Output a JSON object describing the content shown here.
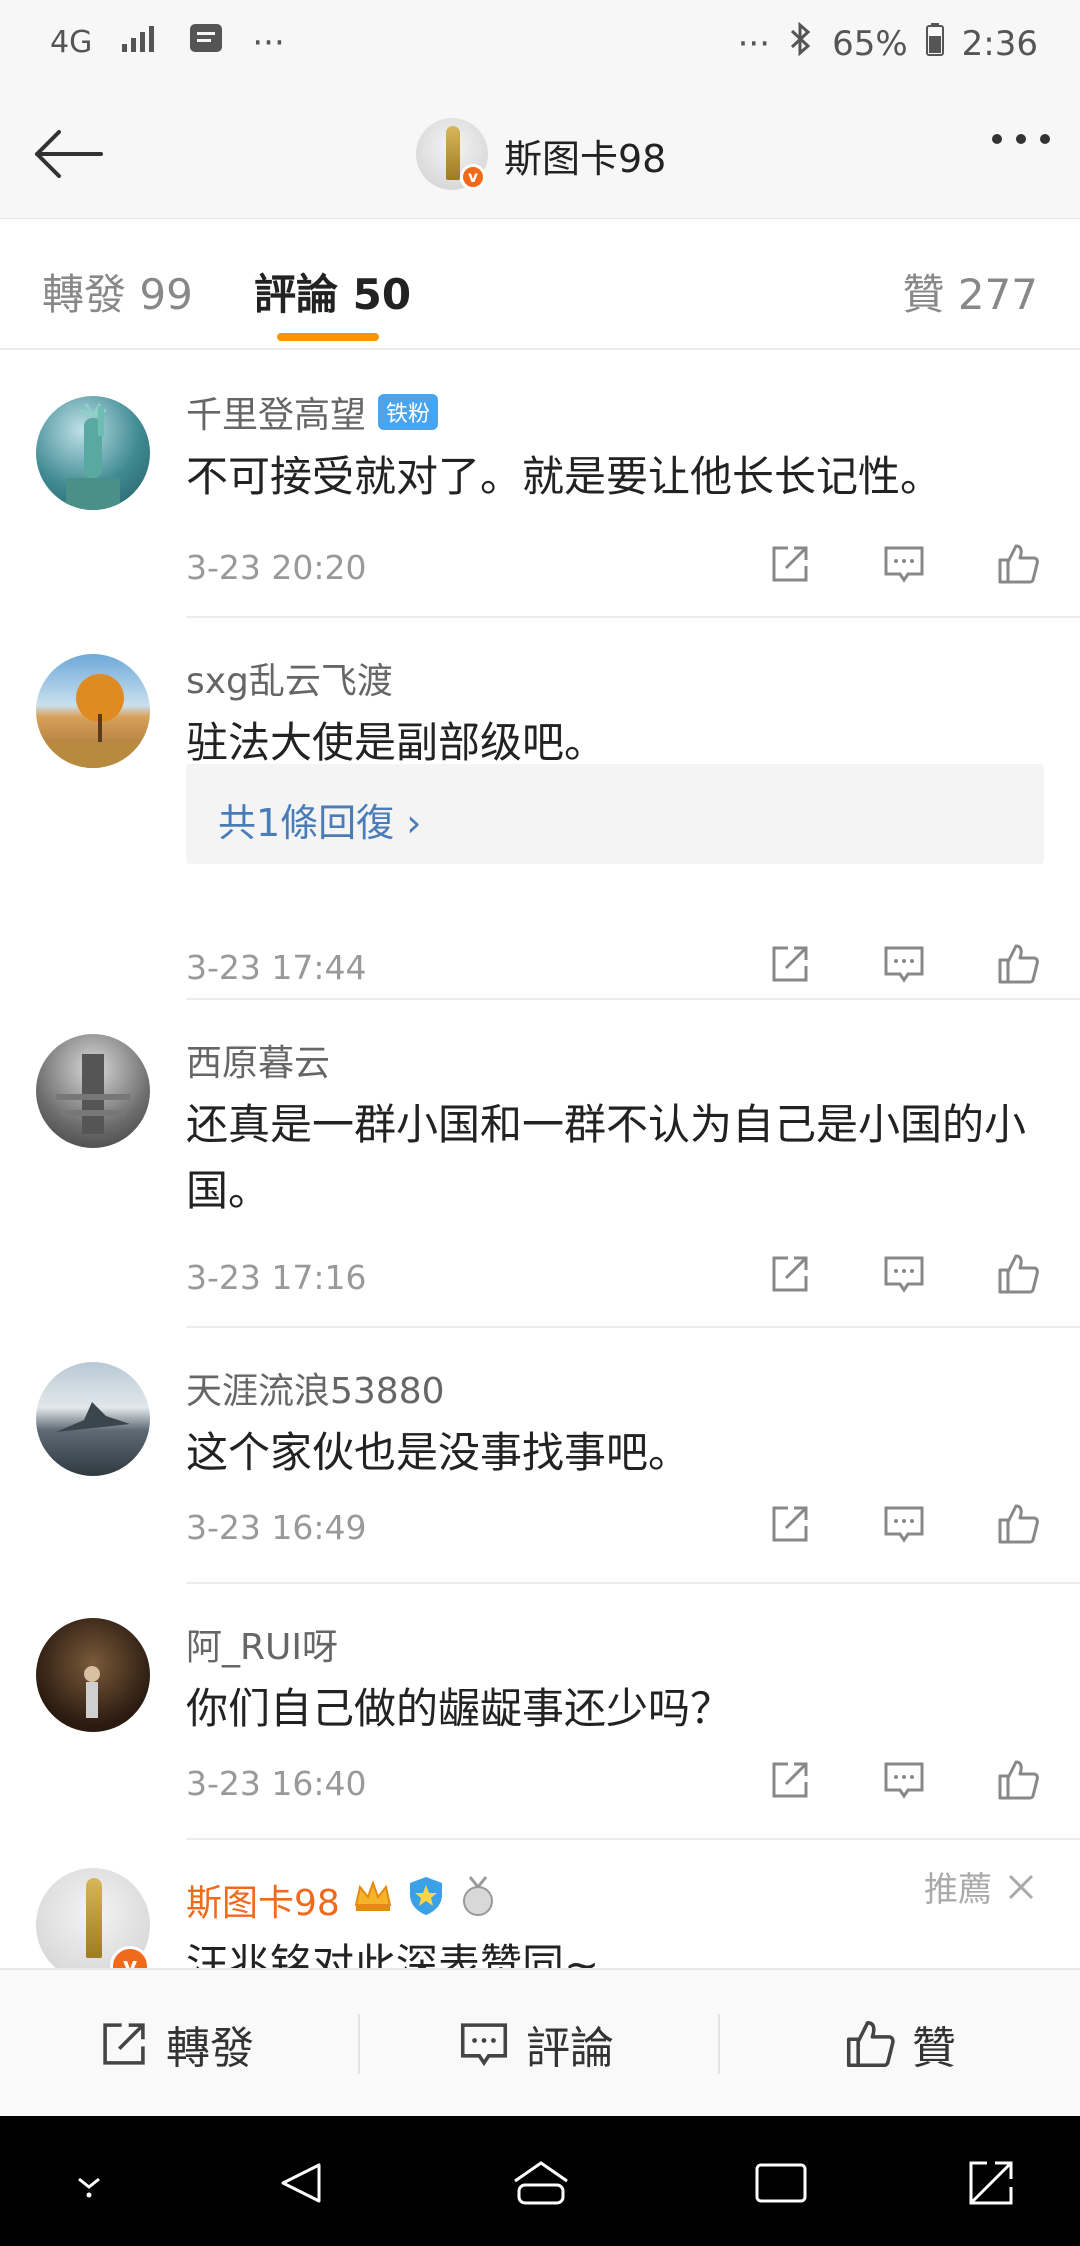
{
  "status_bar": {
    "network": "4G",
    "ellipsis_left": "···",
    "ellipsis_right": "···",
    "battery": "65%",
    "time": "2:36"
  },
  "header": {
    "title": "斯图卡98",
    "verified_badge": "v"
  },
  "tabs": [
    {
      "label": "轉發",
      "count": "99"
    },
    {
      "label": "評論",
      "count": "50"
    },
    {
      "label": "贊",
      "count": "277"
    }
  ],
  "comments": [
    {
      "user": "千里登高望",
      "badge": "铁粉",
      "text": "不可接受就对了。就是要让他长长记性。",
      "time": "3-23 20:20"
    },
    {
      "user": "sxg乱云飞渡",
      "text": "驻法大使是副部级吧。",
      "reply_label": "共1條回復 ›",
      "time": "3-23 17:44"
    },
    {
      "user": "西原暮云",
      "text": "还真是一群小国和一群不认为自己是小国的小国。",
      "time": "3-23 17:16"
    },
    {
      "user": "天涯流浪53880",
      "text": "这个家伙也是没事找事吧。",
      "time": "3-23 16:49"
    },
    {
      "user": "阿_RUI呀",
      "text": "你们自己做的龌龊事还少吗？",
      "time": "3-23 16:40"
    },
    {
      "user": "斯图卡98",
      "text": "汪兆铭对此深表赞同~",
      "recommend": "推薦"
    }
  ],
  "bottom_bar": {
    "repost": "轉發",
    "comment": "評論",
    "like": "贊"
  },
  "colors": {
    "accent": "#f39800",
    "author_name": "#f06a1c",
    "link": "#4a7db8"
  }
}
